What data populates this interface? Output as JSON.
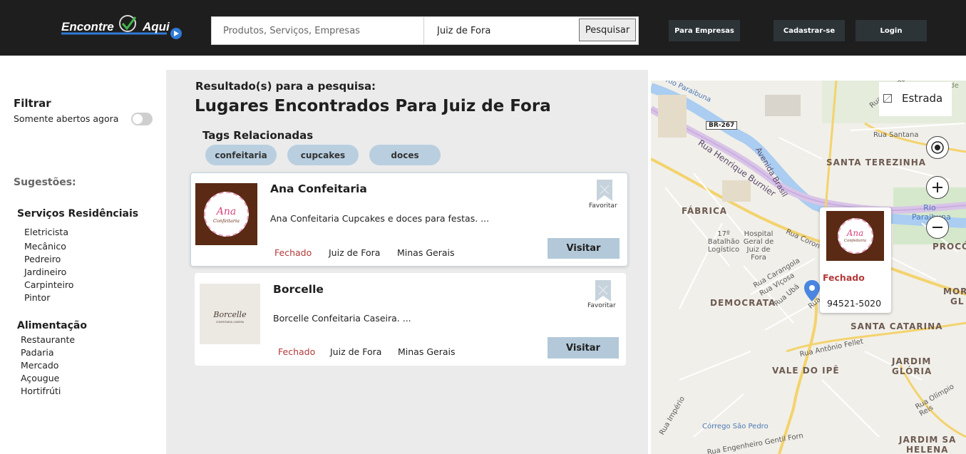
{
  "header": {
    "logo_text_1": "Encontre",
    "logo_text_2": "Aqui",
    "search_placeholder": "Produtos, Serviços, Empresas",
    "city_value": "Juiz de Fora",
    "search_button": "Pesquisar",
    "nav": [
      "Para Empresas",
      "Cadastrar-se",
      "Login"
    ]
  },
  "sidebar": {
    "filter_title": "Filtrar",
    "open_now_label": "Somente abertos agora",
    "suggestions_title": "Sugestões:",
    "groups": [
      {
        "title": "Serviços Residênciais",
        "items": [
          "Eletricista",
          "Mecânico",
          "Pedreiro",
          "Jardineiro",
          "Carpinteiro",
          "Pintor"
        ]
      },
      {
        "title": "Alimentação",
        "items": [
          "Restaurante",
          "Padaria",
          "Mercado",
          "Açougue",
          "Hortifrúti"
        ]
      }
    ]
  },
  "results": {
    "subtitle": "Resultado(s) para a pesquisa:",
    "title": "Lugares Encontrados Para Juiz de Fora",
    "tags_title": "Tags Relacionadas",
    "tags": [
      "confeitaria",
      "cupcakes",
      "doces"
    ],
    "cards": [
      {
        "name": "Ana Confeitaria",
        "logo_text": "Ana",
        "logo_sub": "Confeitaria",
        "description": "Ana Confeitaria Cupcakes e doces para festas. ...",
        "status": "Fechado",
        "city": "Juiz de Fora",
        "state": "Minas Gerais",
        "favorite_label": "Favoritar",
        "visit_label": "Visitar"
      },
      {
        "name": "Borcelle",
        "logo_text": "Borcelle",
        "logo_sub": "CONFEITARIA CASEIRA",
        "description": "Borcelle Confeitaria Caseira. ...",
        "status": "Fechado",
        "city": "Juiz de Fora",
        "state": "Minas Gerais",
        "favorite_label": "Favoritar",
        "visit_label": "Visitar"
      }
    ]
  },
  "map": {
    "layer_label": "Estrada",
    "popup": {
      "status": "Fechado",
      "phone": "94521-5020",
      "logo_text": "Ana",
      "logo_sub": "Confeitaria"
    },
    "neighborhoods": [
      "SANTA TEREZINHA",
      "FÁBRICA",
      "PROCÓ",
      "DEMOCRATA",
      "SANTA CATARINA",
      "VALE DO IPÊ",
      "JARDIM",
      "GLÓRIA",
      "MOR",
      "GL",
      "JARDIM SA",
      "HELENA",
      "Saudade"
    ],
    "streets": [
      "Rio Paraibuna",
      "BR-267",
      "Rua Henrique Burnier",
      "Avenida Brasil",
      "Rua Santana",
      "Rua Alexandre",
      "Rua Coronel",
      "Rua Carangola",
      "Rua Viçosa",
      "Rua Ubá",
      "Rua Muriaé",
      "Rua Antônio Fellet",
      "Rua Olímpio Reis",
      "Rua Império",
      "Córrego São Pedro",
      "Rua Engenheiro Gentil Forn",
      "17º Batalhão Logístico",
      "Hospital Geral de Juiz de Fora",
      "Rio Paraibuna"
    ]
  },
  "colors": {
    "header_bg": "#1e1e1e",
    "accent": "#b3c9d9",
    "closed": "#b33a3a",
    "logo_brown": "#5a2a14"
  }
}
